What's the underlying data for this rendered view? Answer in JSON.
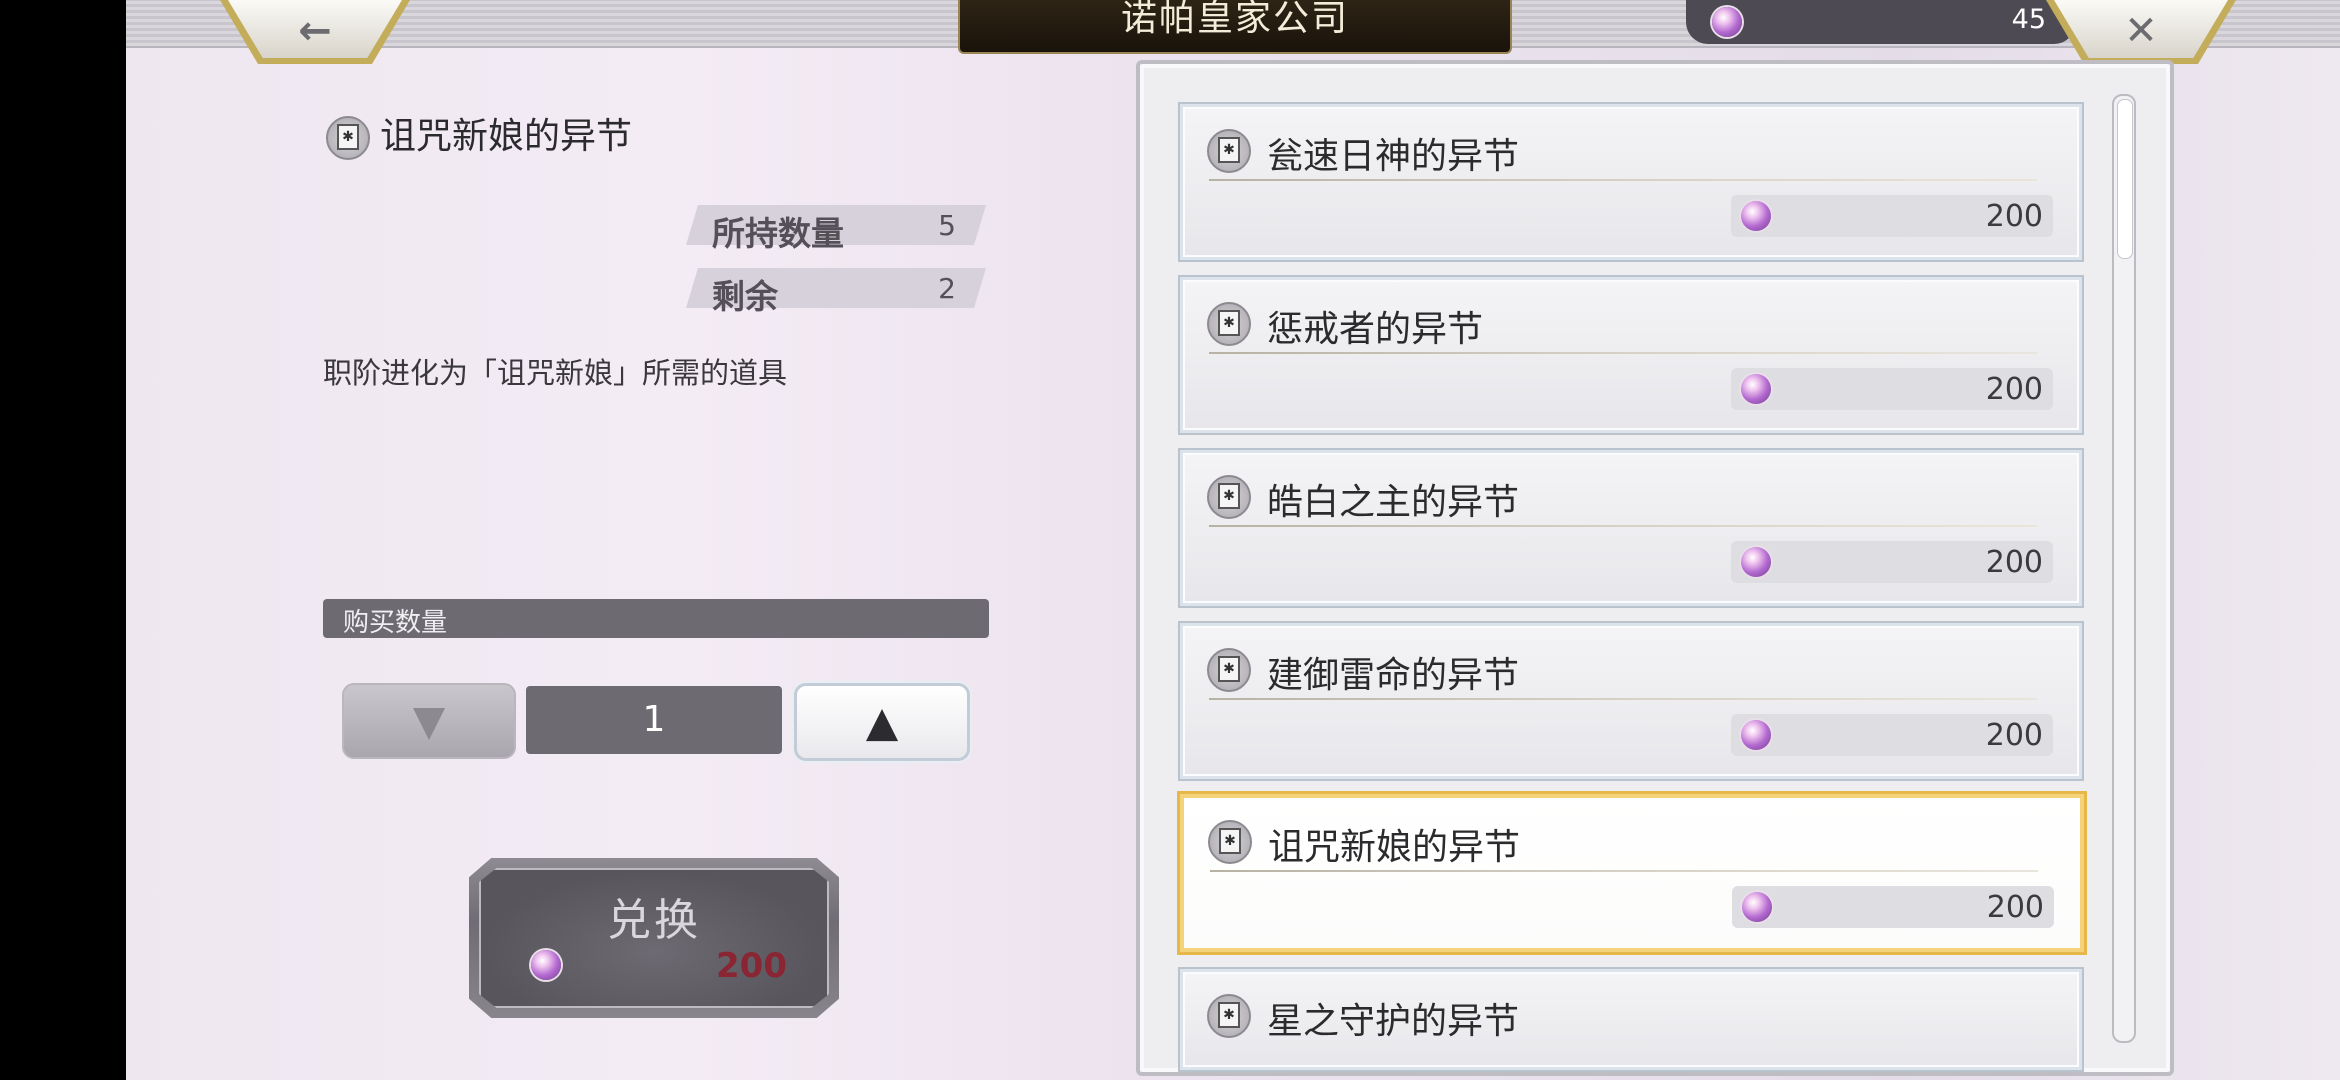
{
  "header": {
    "back_icon": "arrow-left",
    "close_icon": "close-x",
    "title": "诺帕皇家公司",
    "currency_amount": "45"
  },
  "detail": {
    "title": "诅咒新娘的异节",
    "owned_label": "所持数量",
    "owned_value": "5",
    "remaining_label": "剩余",
    "remaining_value": "2",
    "description": "职阶进化为「诅咒新娘」所需的道具",
    "qty_label": "购买数量",
    "qty_value": "1",
    "exchange_label": "兑换",
    "exchange_cost": "200"
  },
  "items": [
    {
      "name": "瓮速日神的异节",
      "price": "200",
      "selected": false
    },
    {
      "name": "惩戒者的异节",
      "price": "200",
      "selected": false
    },
    {
      "name": "皓白之主的异节",
      "price": "200",
      "selected": false
    },
    {
      "name": "建御雷命的异节",
      "price": "200",
      "selected": false
    },
    {
      "name": "诅咒新娘的异节",
      "price": "200",
      "selected": true
    },
    {
      "name": "星之守护的异节",
      "price": "",
      "selected": false
    }
  ],
  "colors": {
    "selected_border": "#f4d37a",
    "cost_text": "#8a2533",
    "gem": "#b46ad0"
  }
}
